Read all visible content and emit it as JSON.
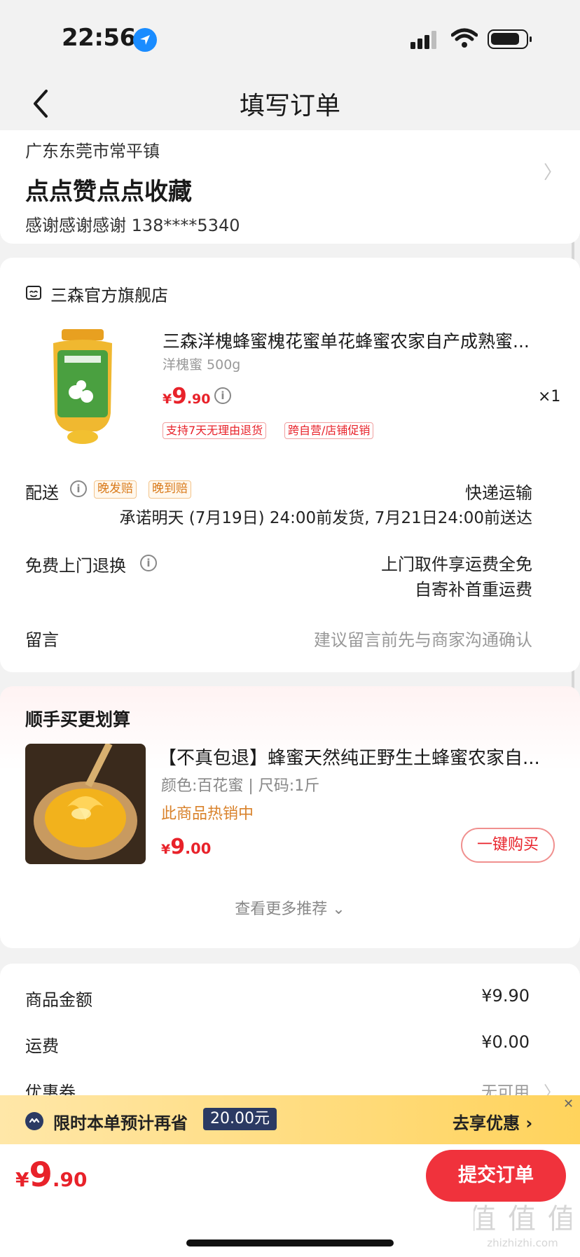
{
  "status_bar": {
    "time": "22:56"
  },
  "nav": {
    "title": "填写订单"
  },
  "address": {
    "region": "广东东莞市常平镇",
    "detail": "点点赞点点收藏",
    "contact": "感谢感谢感谢   138****5340"
  },
  "store": {
    "name": "三森官方旗舰店"
  },
  "product": {
    "title": "三森洋槐蜂蜜槐花蜜单花蜂蜜农家自产成熟蜜...",
    "spec": "洋槐蜜 500g",
    "price_yen": "¥",
    "price_int": "9",
    "price_dec": ".90",
    "qty": "×1",
    "tags": [
      "支持7天无理由退货",
      "跨自营/店铺促销"
    ]
  },
  "delivery": {
    "label": "配送",
    "badges": [
      "晚发赔",
      "晚到赔"
    ],
    "method": "快递运输",
    "promise": "承诺明天 (7月19日) 24:00前发货, 7月21日24:00前送达"
  },
  "return": {
    "label": "免费上门退换",
    "line1": "上门取件享运费全免",
    "line2": "自寄补首重运费"
  },
  "message": {
    "label": "留言",
    "placeholder": "建议留言前先与商家沟通确认"
  },
  "recommend": {
    "title": "顺手买更划算",
    "name": "【不真包退】蜂蜜天然纯正野生土蜂蜜农家自...",
    "spec": "颜色:百花蜜  |  尺码:1斤",
    "hot": "此商品热销中",
    "price_yen": "¥",
    "price_int": "9",
    "price_dec": ".00",
    "buy_label": "一键购买",
    "more_label": "查看更多推荐 ⌄"
  },
  "summary": {
    "goods_label": "商品金额",
    "goods_value": "¥9.90",
    "shipping_label": "运费",
    "shipping_value": "¥0.00",
    "coupon_label": "优惠券",
    "coupon_value": "无可用"
  },
  "promo": {
    "text": "限时本单预计再省",
    "amount": "20.00元",
    "action": "去享优惠 ›",
    "close": "✕"
  },
  "footer": {
    "total_yen": "¥",
    "total_int": "9",
    "total_dec": ".90",
    "submit_label": "提交订单"
  },
  "watermark": {
    "text": "值 值 值",
    "url": "zhizhizhi.com"
  },
  "colors": {
    "accent_red": "#e8222a",
    "submit_bg": "#f0323c",
    "promo_bg": "#ffd35c",
    "hot_orange": "#d9822b"
  }
}
